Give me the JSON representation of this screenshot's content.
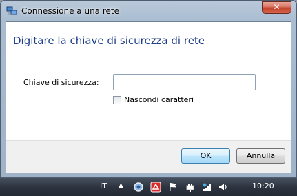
{
  "window": {
    "title": "Connessione a una rete",
    "close_glyph": "✕"
  },
  "dialog": {
    "heading": "Digitare la chiave di sicurezza di rete",
    "security_key_label": "Chiave di sicurezza:",
    "security_key_value": "",
    "hide_chars_label": "Nascondi caratteri",
    "hide_chars_checked": false
  },
  "buttons": {
    "ok": "OK",
    "cancel": "Annulla"
  },
  "taskbar": {
    "language": "IT",
    "show_hidden_glyph": "▲",
    "clock": "10:20",
    "tray_icons": [
      "network-icon",
      "antivirus-icon",
      "action-center-flag-icon",
      "power-icon",
      "wireless-network-icon",
      "volume-icon"
    ]
  },
  "colors": {
    "heading": "#1e3f8a",
    "close_button": "#c2402a",
    "taskbar": "#2d3440"
  }
}
